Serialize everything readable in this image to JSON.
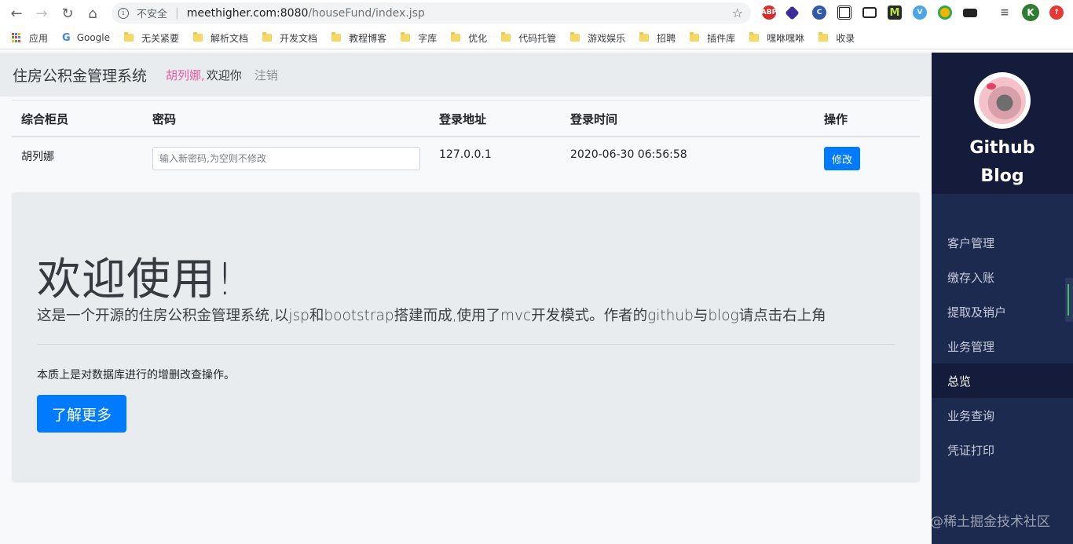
{
  "browser": {
    "security_label": "不安全",
    "url_host": "meethigher.com:8080",
    "url_path": "/houseFund/index.jsp",
    "profile_initial": "K",
    "extensions": [
      "abp-icon",
      "shield-icon",
      "ext-icon",
      "qr-icon",
      "window-icon",
      "m-icon",
      "vue-icon",
      "chrome-icon",
      "glasses-icon"
    ]
  },
  "bookmarks": {
    "apps": "应用",
    "google": "Google",
    "items": [
      "无关紧要",
      "解析文档",
      "开发文档",
      "教程博客",
      "字库",
      "优化",
      "代码托管",
      "游戏娱乐",
      "招聘",
      "插件库",
      "嘿咻嘿咻",
      "收录"
    ]
  },
  "header": {
    "brand": "住房公积金管理系统",
    "user": "胡列娜,",
    "welcome": "欢迎你",
    "logout": "注销"
  },
  "table": {
    "headers": [
      "综合柜员",
      "密码",
      "登录地址",
      "登录时间",
      "操作"
    ],
    "row": {
      "name": "胡列娜",
      "password_placeholder": "输入新密码,为空则不修改",
      "address": "127.0.0.1",
      "time": "2020-06-30 06:56:58",
      "action": "修改"
    }
  },
  "jumbotron": {
    "title": "欢迎使用!",
    "lead": "这是一个开源的住房公积金管理系统,以jsp和bootstrap搭建而成,使用了mvc开发模式。作者的github与blog请点击右上角",
    "note": "本质上是对数据库进行的增删改查操作。",
    "button": "了解更多"
  },
  "sidebar": {
    "title_line1": "Github",
    "title_line2": "Blog",
    "items": [
      "客户管理",
      "缴存入账",
      "提取及销户",
      "业务管理",
      "总览",
      "业务查询",
      "凭证打印"
    ],
    "active_index": 4
  },
  "watermark": "@稀土掘金技术社区",
  "colors": {
    "primary": "#007bff",
    "sidebar": "#1d2a4f",
    "sidebar_dark": "#151b3a",
    "user_highlight": "#e45c9e"
  }
}
